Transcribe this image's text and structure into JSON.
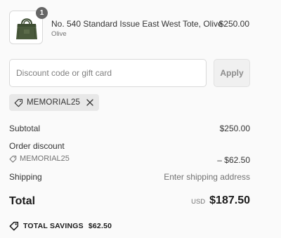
{
  "line_item": {
    "quantity": "1",
    "name": "No. 540 Standard Issue East West Tote, Olive",
    "variant": "Olive",
    "price": "$250.00",
    "thumbnail_icon": "olive-tote-bag-image"
  },
  "discount": {
    "placeholder": "Discount code or gift card",
    "value": "",
    "apply_label": "Apply",
    "applied_code": "MEMORIAL25",
    "tag_icon": "tag-icon",
    "remove_icon": "close-icon"
  },
  "summary": {
    "subtotal_label": "Subtotal",
    "subtotal_value": "$250.00",
    "order_discount_label": "Order discount",
    "discount_code": "MEMORIAL25",
    "discount_value": "– $62.50",
    "shipping_label": "Shipping",
    "shipping_value": "Enter shipping address",
    "total_label": "Total",
    "total_currency": "USD",
    "total_value": "$187.50",
    "savings_label": "TOTAL SAVINGS",
    "savings_value": "$62.50"
  },
  "colors": {
    "background": "#fafafa",
    "text": "#333333",
    "muted_text": "#737373",
    "badge": "#666666",
    "chip_background": "#e8e8e8",
    "olive_product": "#4a5a3c"
  }
}
